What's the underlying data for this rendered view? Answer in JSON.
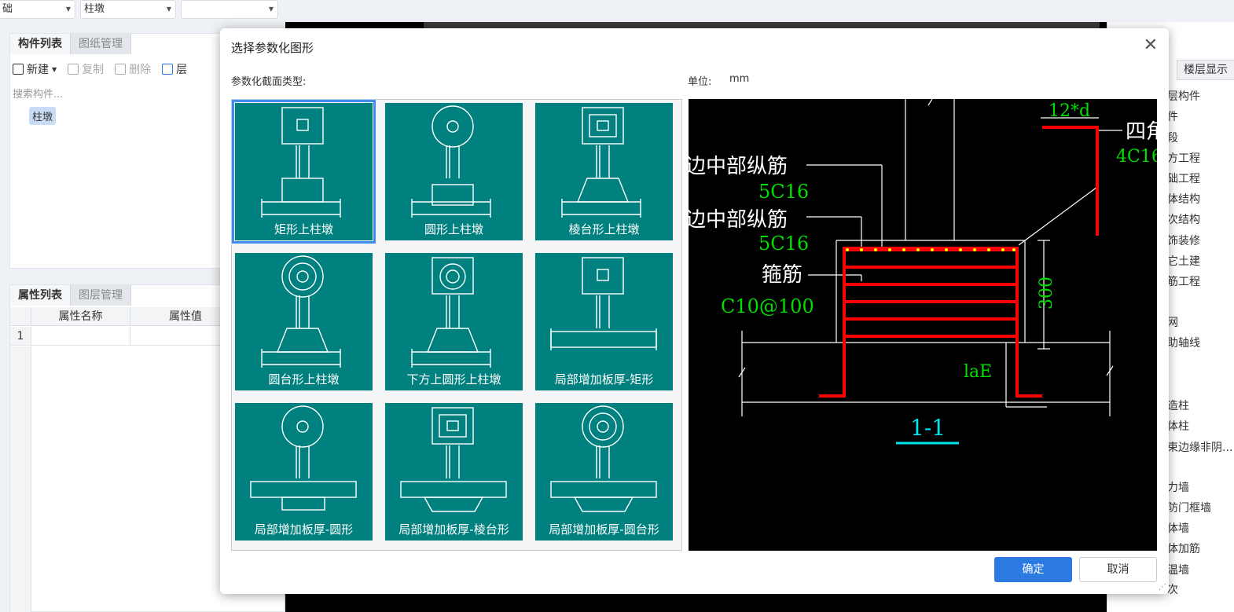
{
  "top_bar": {
    "combo1": "础",
    "combo2": "柱墩",
    "combo3": ""
  },
  "component_panel": {
    "tabs": [
      "构件列表",
      "图纸管理"
    ],
    "toolbar": {
      "new": "新建",
      "copy": "复制",
      "delete": "删除",
      "layer": "层"
    },
    "search_placeholder": "搜索构件...",
    "items": [
      "柱墩"
    ]
  },
  "property_panel": {
    "tabs": [
      "属性列表",
      "图层管理"
    ],
    "columns": [
      "属性名称",
      "属性值"
    ],
    "rows": [
      {
        "num": "1",
        "name": "",
        "value": ""
      }
    ]
  },
  "right_panel": {
    "tab": "楼层显示",
    "items": [
      "层构件",
      "件",
      "段",
      "方工程",
      "础工程",
      "体结构",
      "次结构",
      "饰装修",
      "它土建",
      "筋工程",
      "网",
      "助轴线",
      "造柱",
      "体柱",
      "束边缘非阴...",
      "力墙",
      "防门框墙",
      "体墙",
      "体加筋",
      "温墙",
      "次"
    ]
  },
  "dialog": {
    "title": "选择参数化图形",
    "section_label": "参数化截面类型:",
    "unit_label": "单位:",
    "unit_value": "mm",
    "shapes": [
      "矩形上柱墩",
      "圆形上柱墩",
      "棱台形上柱墩",
      "圆台形上柱墩",
      "下方上圆形上柱墩",
      "局部增加板厚-矩形",
      "局部增加板厚-圆形",
      "局部增加板厚-棱台形",
      "局部增加板厚-圆台形"
    ],
    "selected_index": 0,
    "ok_label": "确定",
    "cancel_label": "取消"
  },
  "preview": {
    "label_long1": "边中部纵筋",
    "label_long1_val": "5C16",
    "label_long2": "边中部纵筋",
    "label_long2_val": "5C16",
    "label_stirrup": "箍筋",
    "label_stirrup_val": "C10@100",
    "label_corner": "四角",
    "label_corner_val": "4C16",
    "dim_anchor": "12*d",
    "dim_height": "300",
    "dim_lae": "laE",
    "section_name": "1-1"
  },
  "colors": {
    "accent": "#2a7ae2",
    "tile": "#00807e",
    "rebar": "#ff0000",
    "dim_text": "#00e000",
    "section_text": "#00e5ee"
  }
}
